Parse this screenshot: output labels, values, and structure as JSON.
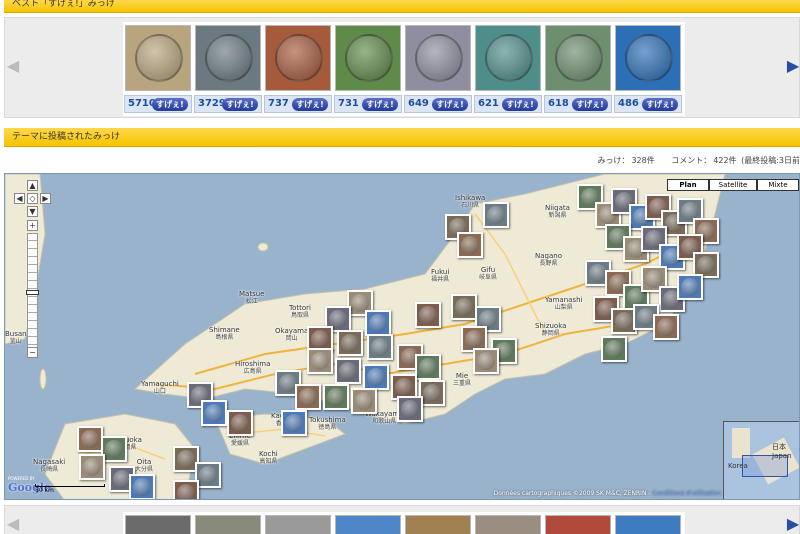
{
  "section_top": {
    "title": "ベスト「すげぇ!」みっけ"
  },
  "section_map": {
    "title": "テーマに投稿されたみっけ"
  },
  "best_carousel": {
    "items": [
      {
        "count": "5710",
        "button": "すげぇ!",
        "tone": "#b8a57e"
      },
      {
        "count": "3729",
        "button": "すげぇ!",
        "tone": "#6b7a80"
      },
      {
        "count": "737",
        "button": "すげぇ!",
        "tone": "#a65a3c"
      },
      {
        "count": "731",
        "button": "すげぇ!",
        "tone": "#5f8a4a"
      },
      {
        "count": "649",
        "button": "すげぇ!",
        "tone": "#8e8ea0"
      },
      {
        "count": "621",
        "button": "すげぇ!",
        "tone": "#4e8e8a"
      },
      {
        "count": "618",
        "button": "すげぇ!",
        "tone": "#6e8e70"
      },
      {
        "count": "486",
        "button": "すげぇ!",
        "tone": "#2d6fb6"
      }
    ]
  },
  "bottom_carousel": {
    "tones": [
      "#6b6b6b",
      "#8a8a7a",
      "#9a9a9a",
      "#4f86c8",
      "#a08050",
      "#9a8e80",
      "#b04a3a",
      "#3d7cc0"
    ]
  },
  "stats": {
    "mikke_label": "みっけ：",
    "mikke_value": "328件",
    "comment_label": "コメント：",
    "comment_value": "422件",
    "last_post": "(最終投稿:3日前"
  },
  "map": {
    "type_buttons": [
      "Plan",
      "Satellite",
      "Mixte"
    ],
    "active_type": "Plan",
    "credits": "Données cartographiques ©2009 SK M&C, ZENRIN - ",
    "credits_link": "Conditions d'utilisation",
    "powered_by": "POWERED BY",
    "google_logo": "Google",
    "scale_label": "50 km",
    "overview_labels": [
      "日本",
      "Japan",
      "Korea"
    ],
    "cities": [
      {
        "name": "Ishikawa",
        "sub": "石川県"
      },
      {
        "name": "Niigata",
        "sub": "新潟県"
      },
      {
        "name": "Nagano",
        "sub": "長野県"
      },
      {
        "name": "Gifu",
        "sub": "岐阜県"
      },
      {
        "name": "Fukui",
        "sub": "福井県"
      },
      {
        "name": "Matsue",
        "sub": "松江"
      },
      {
        "name": "Tottori",
        "sub": "鳥取県"
      },
      {
        "name": "Shimane",
        "sub": "島根県"
      },
      {
        "name": "Okayama",
        "sub": "岡山"
      },
      {
        "name": "Hiroshima",
        "sub": "広島県"
      },
      {
        "name": "Yamaguchi",
        "sub": "山口"
      },
      {
        "name": "Yamanashi",
        "sub": "山梨県"
      },
      {
        "name": "Shizuoka",
        "sub": "静岡県"
      },
      {
        "name": "Mie",
        "sub": "三重県"
      },
      {
        "name": "Wakayama",
        "sub": "和歌山県"
      },
      {
        "name": "Tokushima",
        "sub": "徳島県"
      },
      {
        "name": "Kochi",
        "sub": "高知県"
      },
      {
        "name": "Oita",
        "sub": "大分県"
      },
      {
        "name": "Fukuoka",
        "sub": "福岡県"
      },
      {
        "name": "Nagasaki",
        "sub": "長崎県"
      },
      {
        "name": "Busan",
        "sub": "釜山"
      },
      {
        "name": "Kagawa",
        "sub": "香川県"
      },
      {
        "name": "Ehime",
        "sub": "愛媛県"
      }
    ],
    "pin_tones": [
      "#7a6a58",
      "#6c7c86",
      "#8a6a52",
      "#5e7a5a",
      "#9a8b76",
      "#6a6a7a",
      "#4c7ab8",
      "#7e5c4c"
    ]
  }
}
